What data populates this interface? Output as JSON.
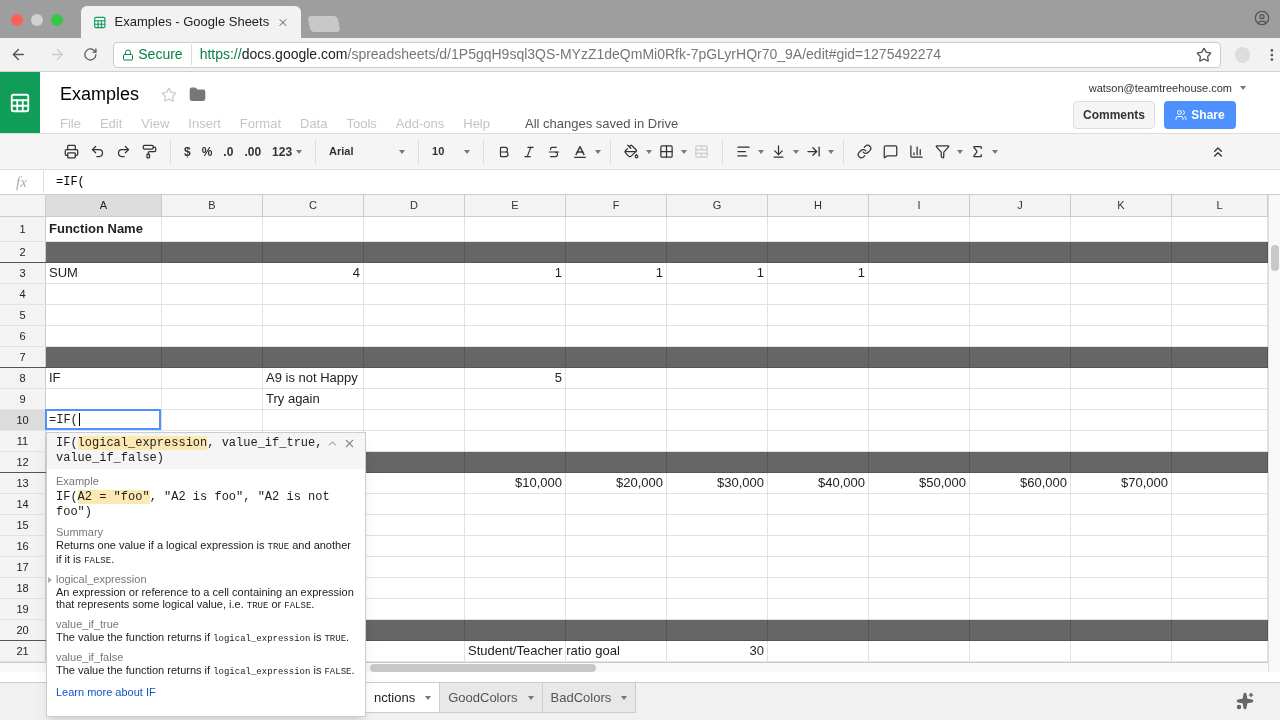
{
  "browser": {
    "tab_title": "Examples - Google Sheets",
    "secure_label": "Secure",
    "url_scheme": "https://",
    "url_host": "docs.google.com",
    "url_path": "/spreadsheets/d/1P5gqH9sql3QS-MYzZ1deQmMi0Rfk-7pGLyrHQr70_9A/edit#gid=1275492274"
  },
  "doc": {
    "title": "Examples",
    "menu": [
      {
        "label": "File",
        "disabled": true
      },
      {
        "label": "Edit",
        "disabled": true
      },
      {
        "label": "View",
        "disabled": true
      },
      {
        "label": "Insert",
        "disabled": true
      },
      {
        "label": "Format",
        "disabled": true
      },
      {
        "label": "Data",
        "disabled": true
      },
      {
        "label": "Tools",
        "disabled": true
      },
      {
        "label": "Add-ons",
        "disabled": true
      },
      {
        "label": "Help",
        "disabled": true
      }
    ],
    "save_status": "All changes saved in Drive",
    "account": "watson@teamtreehouse.com",
    "comments_button": "Comments",
    "share_button": "Share"
  },
  "toolbar": {
    "currency": "$",
    "percent": "%",
    "decrease_decimals": ".0",
    "increase_decimals": ".00",
    "number_format": "123",
    "font": "Arial",
    "font_size": "10"
  },
  "formula_bar": {
    "fx": "fx",
    "value": "=IF("
  },
  "columns": [
    {
      "label": "A",
      "selected": true
    },
    {
      "label": "B",
      "selected": false
    },
    {
      "label": "C",
      "selected": false
    },
    {
      "label": "D",
      "selected": false
    },
    {
      "label": "E",
      "selected": false
    },
    {
      "label": "F",
      "selected": false
    },
    {
      "label": "G",
      "selected": false
    },
    {
      "label": "H",
      "selected": false
    },
    {
      "label": "I",
      "selected": false
    },
    {
      "label": "J",
      "selected": false
    },
    {
      "label": "K",
      "selected": false
    },
    {
      "label": "L",
      "selected": false
    }
  ],
  "rows": [
    {
      "label": "1",
      "selected": false,
      "dark": false,
      "cells": {
        "a": {
          "kind": "header",
          "text": "Function Name"
        }
      }
    },
    {
      "label": "2",
      "selected": false,
      "dark": true
    },
    {
      "label": "3",
      "selected": false,
      "dark": false,
      "cells": {
        "a": {
          "kind": "text",
          "text": "SUM"
        },
        "c": {
          "kind": "number",
          "text": "4"
        },
        "e": {
          "kind": "number",
          "text": "1"
        },
        "f": {
          "kind": "number",
          "text": "1"
        },
        "g": {
          "kind": "number",
          "text": "1"
        },
        "h": {
          "kind": "number",
          "text": "1"
        }
      }
    },
    {
      "label": "4",
      "selected": false,
      "dark": false
    },
    {
      "label": "5",
      "selected": false,
      "dark": false
    },
    {
      "label": "6",
      "selected": false,
      "dark": false
    },
    {
      "label": "7",
      "selected": false,
      "dark": true
    },
    {
      "label": "8",
      "selected": false,
      "dark": false,
      "cells": {
        "a": {
          "kind": "text",
          "text": "IF"
        },
        "c": {
          "kind": "text",
          "text": "A9 is not Happy"
        },
        "e": {
          "kind": "number",
          "text": "5"
        }
      }
    },
    {
      "label": "9",
      "selected": false,
      "dark": false,
      "cells": {
        "c": {
          "kind": "text",
          "text": "Try again"
        }
      }
    },
    {
      "label": "10",
      "selected": true,
      "dark": false,
      "cells": {
        "a": {
          "kind": "editing",
          "text": "=IF("
        }
      }
    },
    {
      "label": "11",
      "selected": false,
      "dark": false
    },
    {
      "label": "12",
      "selected": false,
      "dark": true
    },
    {
      "label": "13",
      "selected": false,
      "dark": false,
      "cells": {
        "e": {
          "kind": "number",
          "text": "$10,000"
        },
        "f": {
          "kind": "number",
          "text": "$20,000"
        },
        "g": {
          "kind": "number",
          "text": "$30,000"
        },
        "h": {
          "kind": "number",
          "text": "$40,000"
        },
        "i": {
          "kind": "number",
          "text": "$50,000"
        },
        "j": {
          "kind": "number",
          "text": "$60,000"
        },
        "k": {
          "kind": "number",
          "text": "$70,000"
        }
      }
    },
    {
      "label": "14",
      "selected": false,
      "dark": false
    },
    {
      "label": "15",
      "selected": false,
      "dark": false
    },
    {
      "label": "16",
      "selected": false,
      "dark": false
    },
    {
      "label": "17",
      "selected": false,
      "dark": false
    },
    {
      "label": "18",
      "selected": false,
      "dark": false
    },
    {
      "label": "19",
      "selected": false,
      "dark": false
    },
    {
      "label": "20",
      "selected": false,
      "dark": true
    },
    {
      "label": "21",
      "selected": false,
      "dark": false,
      "cells": {
        "e": {
          "kind": "text",
          "text": "Student/Teacher ratio goal"
        },
        "g": {
          "kind": "number",
          "text": "30"
        }
      }
    }
  ],
  "formula_help": {
    "signature": [
      {
        "text": "IF(",
        "highlight": false
      },
      {
        "text": "logical_expression",
        "highlight": true
      },
      {
        "text": ", value_if_true, value_if_false)",
        "highlight": false
      }
    ],
    "example_label": "Example",
    "example": [
      {
        "text": "IF(",
        "highlight": false
      },
      {
        "text": "A2 = \"foo\"",
        "highlight": true
      },
      {
        "text": ", \"A2 is foo\", \"A2 is not foo\")",
        "highlight": false
      }
    ],
    "sections": [
      {
        "title": "Summary",
        "current": false,
        "body": [
          {
            "text": "Returns one value if a logical expression is ",
            "code": false
          },
          {
            "text": "TRUE",
            "code": true
          },
          {
            "text": " and another if it is ",
            "code": false
          },
          {
            "text": "FALSE",
            "code": true
          },
          {
            "text": ".",
            "code": false
          }
        ]
      },
      {
        "title": "logical_expression",
        "current": true,
        "body": [
          {
            "text": "An expression or reference to a cell containing an expression that represents some logical value, i.e. ",
            "code": false
          },
          {
            "text": "TRUE",
            "code": true
          },
          {
            "text": " or ",
            "code": false
          },
          {
            "text": "FALSE",
            "code": true
          },
          {
            "text": ".",
            "code": false
          }
        ]
      },
      {
        "title": "value_if_true",
        "current": false,
        "body": [
          {
            "text": "The value the function returns if ",
            "code": false
          },
          {
            "text": "logical_expression",
            "code": true
          },
          {
            "text": " is ",
            "code": false
          },
          {
            "text": "TRUE",
            "code": true
          },
          {
            "text": ".",
            "code": false
          }
        ]
      },
      {
        "title": "value_if_false",
        "current": false,
        "body": [
          {
            "text": "The value the function returns if ",
            "code": false
          },
          {
            "text": "logical_expression",
            "code": true
          },
          {
            "text": " is ",
            "code": false
          },
          {
            "text": "FALSE",
            "code": true
          },
          {
            "text": ".",
            "code": false
          }
        ]
      }
    ],
    "learn_more": "Learn more about IF"
  },
  "sheet_tabs": [
    {
      "label": "nctions",
      "selected": true
    },
    {
      "label": "GoodColors",
      "selected": false
    },
    {
      "label": "BadColors",
      "selected": false
    }
  ]
}
